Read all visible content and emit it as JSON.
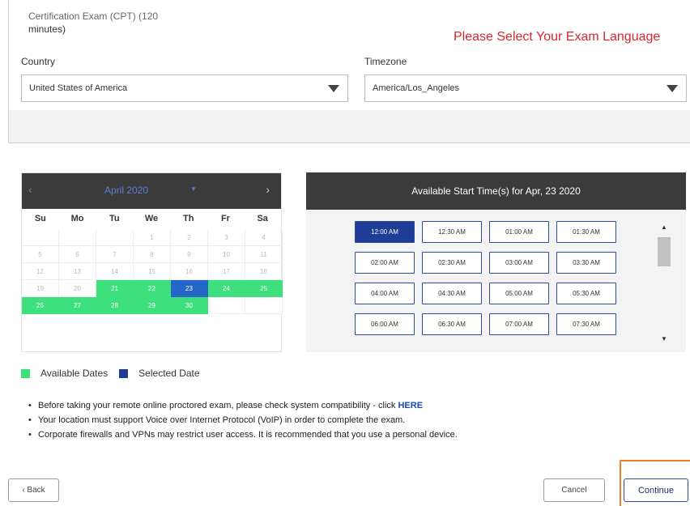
{
  "exam": {
    "name_line1": "Certification Exam (CPT) (120",
    "name_line2": "minutes)"
  },
  "language_notice": "Please Select Your Exam Language",
  "country": {
    "label": "Country",
    "value": "United States of America"
  },
  "timezone": {
    "label": "Timezone",
    "value": "America/Los_Angeles"
  },
  "calendar": {
    "prev": "‹",
    "next": "›",
    "month": "April 2020",
    "caret": "▼",
    "weekdays": [
      "Su",
      "Mo",
      "Tu",
      "We",
      "Th",
      "Fr",
      "Sa"
    ],
    "days": [
      {
        "d": "",
        "s": "blank"
      },
      {
        "d": "",
        "s": "blank"
      },
      {
        "d": "",
        "s": "blank"
      },
      {
        "d": "1",
        "s": "off"
      },
      {
        "d": "2",
        "s": "off"
      },
      {
        "d": "3",
        "s": "off"
      },
      {
        "d": "4",
        "s": "off"
      },
      {
        "d": "5",
        "s": "off"
      },
      {
        "d": "6",
        "s": "off"
      },
      {
        "d": "7",
        "s": "off"
      },
      {
        "d": "8",
        "s": "off"
      },
      {
        "d": "9",
        "s": "off"
      },
      {
        "d": "10",
        "s": "off"
      },
      {
        "d": "11",
        "s": "off"
      },
      {
        "d": "12",
        "s": "off"
      },
      {
        "d": "13",
        "s": "off"
      },
      {
        "d": "14",
        "s": "off"
      },
      {
        "d": "15",
        "s": "off"
      },
      {
        "d": "16",
        "s": "off"
      },
      {
        "d": "17",
        "s": "off"
      },
      {
        "d": "18",
        "s": "off"
      },
      {
        "d": "19",
        "s": "off"
      },
      {
        "d": "20",
        "s": "off"
      },
      {
        "d": "21",
        "s": "avail"
      },
      {
        "d": "22",
        "s": "avail"
      },
      {
        "d": "23",
        "s": "sel"
      },
      {
        "d": "24",
        "s": "avail"
      },
      {
        "d": "25",
        "s": "avail"
      },
      {
        "d": "26",
        "s": "avail"
      },
      {
        "d": "27",
        "s": "avail"
      },
      {
        "d": "28",
        "s": "avail"
      },
      {
        "d": "29",
        "s": "avail"
      },
      {
        "d": "30",
        "s": "avail"
      },
      {
        "d": "",
        "s": "blank"
      },
      {
        "d": "",
        "s": "blank"
      }
    ]
  },
  "times": {
    "title": "Available Start Time(s) for Apr, 23 2020",
    "slots": [
      "12:00 AM",
      "12:30 AM",
      "01:00 AM",
      "01:30 AM",
      "02:00 AM",
      "02:30 AM",
      "03:00 AM",
      "03:30 AM",
      "04:00 AM",
      "04:30 AM",
      "05:00 AM",
      "05:30 AM",
      "06:00 AM",
      "06:30 AM",
      "07:00 AM",
      "07:30 AM"
    ],
    "selected": "12:00 AM",
    "scroll_up": "▲",
    "scroll_down": "▼"
  },
  "legend": {
    "available": "Available Dates",
    "selected": "Selected Date"
  },
  "notes": {
    "n1": "Before taking your remote online proctored exam, please check system compatibility - click ",
    "n1_link": "HERE",
    "n2": "Your location must support Voice over Internet Protocol (VoIP) in order to complete the exam.",
    "n3": "Corporate firewalls and VPNs may restrict user access. It is recommended that you use a personal device."
  },
  "buttons": {
    "back": "‹ Back",
    "cancel": "Cancel",
    "continue": "Continue"
  },
  "colors": {
    "available": "#3ee07e",
    "selected": "#1f3c96",
    "notice": "#d9262c",
    "highlight": "#f07c2a"
  }
}
